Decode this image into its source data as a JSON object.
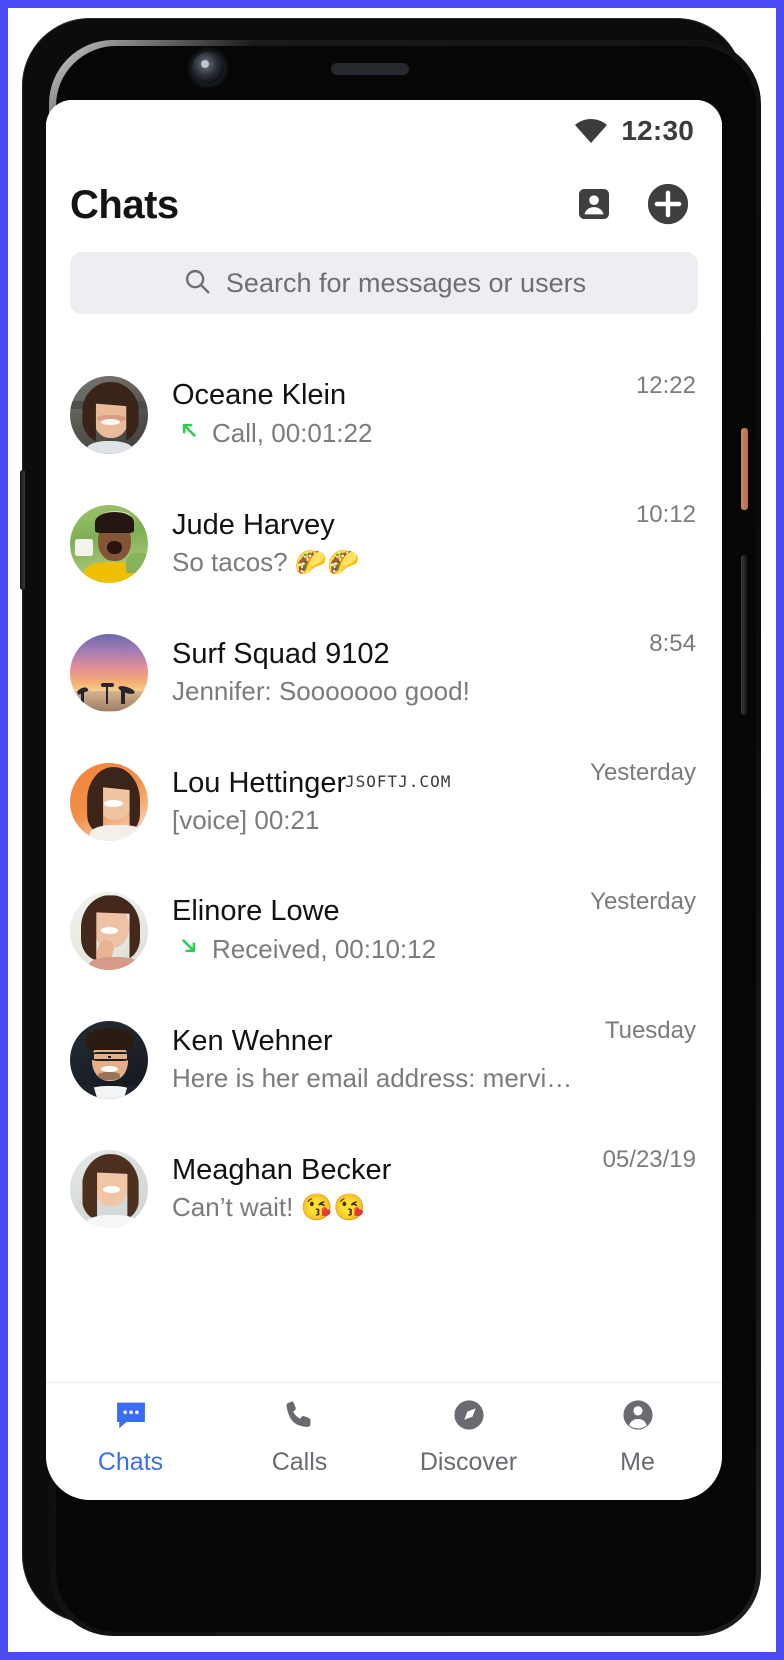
{
  "status_bar": {
    "time": "12:30",
    "wifi_icon": "wifi-icon"
  },
  "header": {
    "title": "Chats",
    "contacts_icon": "contacts-icon",
    "add_icon": "plus-icon"
  },
  "search": {
    "placeholder": "Search for messages or users",
    "value": "",
    "icon": "search-icon"
  },
  "watermark": "JSOFTJ.COM",
  "colors": {
    "accent": "#3a6df0",
    "call_arrow_green": "#2ecc57",
    "primary_text": "#121212",
    "secondary_text": "#7b7b80",
    "search_bg": "#eeeef2",
    "frame": "#0c0c0c",
    "backdrop": "#4b4bf5"
  },
  "chats": [
    {
      "name": "Oceane Klein",
      "preview": "Call, 00:01:22",
      "time": "12:22",
      "call_icon": "call-outgoing-icon",
      "avatar": "oceane-klein-avatar"
    },
    {
      "name": "Jude Harvey",
      "preview": "So tacos? 🌮🌮",
      "time": "10:12",
      "call_icon": "",
      "avatar": "jude-harvey-avatar"
    },
    {
      "name": "Surf Squad 9102",
      "preview": "Jennifer: Sooooooo good!",
      "time": "8:54",
      "call_icon": "",
      "avatar": "surf-squad-avatar"
    },
    {
      "name": "Lou Hettinger",
      "preview": "[voice] 00:21",
      "time": "Yesterday",
      "call_icon": "",
      "avatar": "lou-hettinger-avatar"
    },
    {
      "name": "Elinore Lowe",
      "preview": "Received, 00:10:12",
      "time": "Yesterday",
      "call_icon": "call-incoming-icon",
      "avatar": "elinore-lowe-avatar"
    },
    {
      "name": "Ken Wehner",
      "preview": "Here is her email address: mervi…",
      "time": "Tuesday",
      "call_icon": "",
      "avatar": "ken-wehner-avatar"
    },
    {
      "name": "Meaghan Becker",
      "preview": "Can’t wait! 😘😘",
      "time": "05/23/19",
      "call_icon": "",
      "avatar": "meaghan-becker-avatar"
    }
  ],
  "tabs": [
    {
      "label": "Chats",
      "icon": "chat-bubble-icon",
      "active": true
    },
    {
      "label": "Calls",
      "icon": "phone-icon",
      "active": false
    },
    {
      "label": "Discover",
      "icon": "compass-icon",
      "active": false
    },
    {
      "label": "Me",
      "icon": "person-icon",
      "active": false
    }
  ]
}
